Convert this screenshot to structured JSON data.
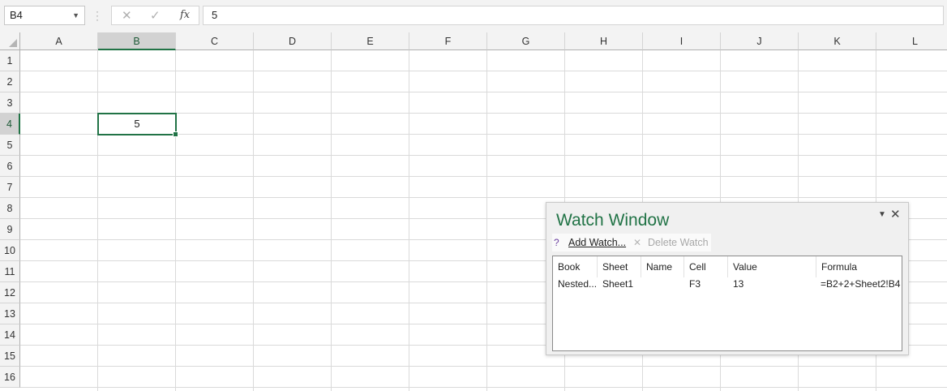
{
  "formula_bar": {
    "name_box": "B4",
    "cancel_icon": "x-icon",
    "enter_icon": "check-icon",
    "fx_label": "fx",
    "formula_value": "5"
  },
  "columns": [
    "A",
    "B",
    "C",
    "D",
    "E",
    "F",
    "G",
    "H",
    "I",
    "J",
    "K",
    "L"
  ],
  "rows": [
    "1",
    "2",
    "3",
    "4",
    "5",
    "6",
    "7",
    "8",
    "9",
    "10",
    "11",
    "12",
    "13",
    "14",
    "15",
    "16"
  ],
  "active_cell": {
    "ref": "B4",
    "value": "5"
  },
  "watch_window": {
    "title": "Watch Window",
    "add_watch_label": "Add Watch...",
    "delete_watch_label": "Delete Watch",
    "headers": [
      "Book",
      "Sheet",
      "Name",
      "Cell",
      "Value",
      "Formula"
    ],
    "rows": [
      {
        "book": "Nested...",
        "sheet": "Sheet1",
        "name": "",
        "cell": "F3",
        "value": "13",
        "formula": "=B2+2+Sheet2!B4"
      }
    ]
  },
  "colors": {
    "accent": "#217346",
    "header_bg": "#f3f3f3",
    "selected_header_bg": "#d2d2d2",
    "gridline": "#dadada"
  }
}
